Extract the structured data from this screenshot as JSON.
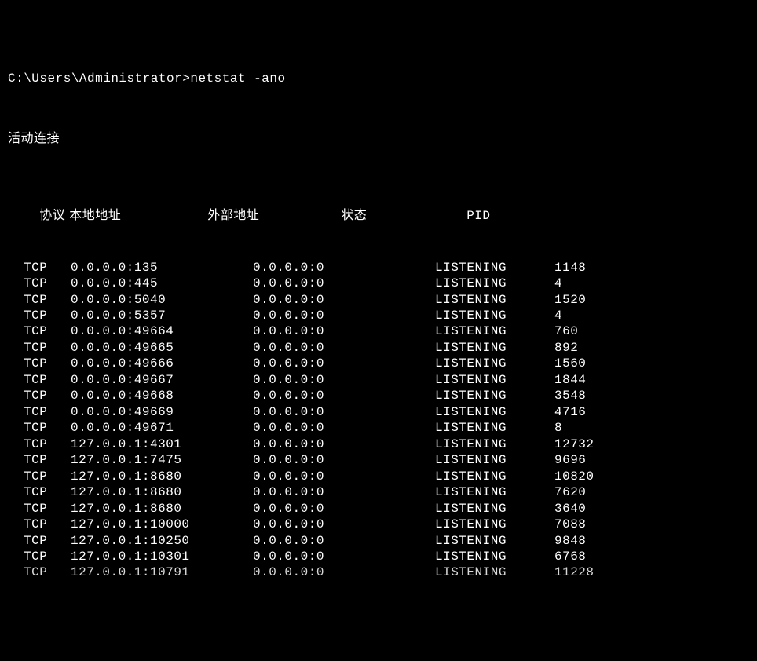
{
  "prompt": "C:\\Users\\Administrator>",
  "command": "netstat -ano",
  "section_title": "活动连接",
  "headers": {
    "proto": "协议",
    "local": "本地地址",
    "foreign": "外部地址",
    "state": "状态",
    "pid": "PID"
  },
  "rows": [
    {
      "proto": "TCP",
      "local": "0.0.0.0:135",
      "foreign": "0.0.0.0:0",
      "state": "LISTENING",
      "pid": "1148"
    },
    {
      "proto": "TCP",
      "local": "0.0.0.0:445",
      "foreign": "0.0.0.0:0",
      "state": "LISTENING",
      "pid": "4"
    },
    {
      "proto": "TCP",
      "local": "0.0.0.0:5040",
      "foreign": "0.0.0.0:0",
      "state": "LISTENING",
      "pid": "1520"
    },
    {
      "proto": "TCP",
      "local": "0.0.0.0:5357",
      "foreign": "0.0.0.0:0",
      "state": "LISTENING",
      "pid": "4"
    },
    {
      "proto": "TCP",
      "local": "0.0.0.0:49664",
      "foreign": "0.0.0.0:0",
      "state": "LISTENING",
      "pid": "760"
    },
    {
      "proto": "TCP",
      "local": "0.0.0.0:49665",
      "foreign": "0.0.0.0:0",
      "state": "LISTENING",
      "pid": "892"
    },
    {
      "proto": "TCP",
      "local": "0.0.0.0:49666",
      "foreign": "0.0.0.0:0",
      "state": "LISTENING",
      "pid": "1560"
    },
    {
      "proto": "TCP",
      "local": "0.0.0.0:49667",
      "foreign": "0.0.0.0:0",
      "state": "LISTENING",
      "pid": "1844"
    },
    {
      "proto": "TCP",
      "local": "0.0.0.0:49668",
      "foreign": "0.0.0.0:0",
      "state": "LISTENING",
      "pid": "3548"
    },
    {
      "proto": "TCP",
      "local": "0.0.0.0:49669",
      "foreign": "0.0.0.0:0",
      "state": "LISTENING",
      "pid": "4716"
    },
    {
      "proto": "TCP",
      "local": "0.0.0.0:49671",
      "foreign": "0.0.0.0:0",
      "state": "LISTENING",
      "pid": "8"
    },
    {
      "proto": "TCP",
      "local": "127.0.0.1:4301",
      "foreign": "0.0.0.0:0",
      "state": "LISTENING",
      "pid": "12732"
    },
    {
      "proto": "TCP",
      "local": "127.0.0.1:7475",
      "foreign": "0.0.0.0:0",
      "state": "LISTENING",
      "pid": "9696"
    },
    {
      "proto": "TCP",
      "local": "127.0.0.1:8680",
      "foreign": "0.0.0.0:0",
      "state": "LISTENING",
      "pid": "10820"
    },
    {
      "proto": "TCP",
      "local": "127.0.0.1:8680",
      "foreign": "0.0.0.0:0",
      "state": "LISTENING",
      "pid": "7620"
    },
    {
      "proto": "TCP",
      "local": "127.0.0.1:8680",
      "foreign": "0.0.0.0:0",
      "state": "LISTENING",
      "pid": "3640"
    },
    {
      "proto": "TCP",
      "local": "127.0.0.1:10000",
      "foreign": "0.0.0.0:0",
      "state": "LISTENING",
      "pid": "7088"
    },
    {
      "proto": "TCP",
      "local": "127.0.0.1:10250",
      "foreign": "0.0.0.0:0",
      "state": "LISTENING",
      "pid": "9848"
    },
    {
      "proto": "TCP",
      "local": "127.0.0.1:10301",
      "foreign": "0.0.0.0:0",
      "state": "LISTENING",
      "pid": "6768"
    },
    {
      "proto": "TCP",
      "local": "127.0.0.1:10791",
      "foreign": "0.0.0.0:0",
      "state": "LISTENING",
      "pid": "11228"
    }
  ]
}
